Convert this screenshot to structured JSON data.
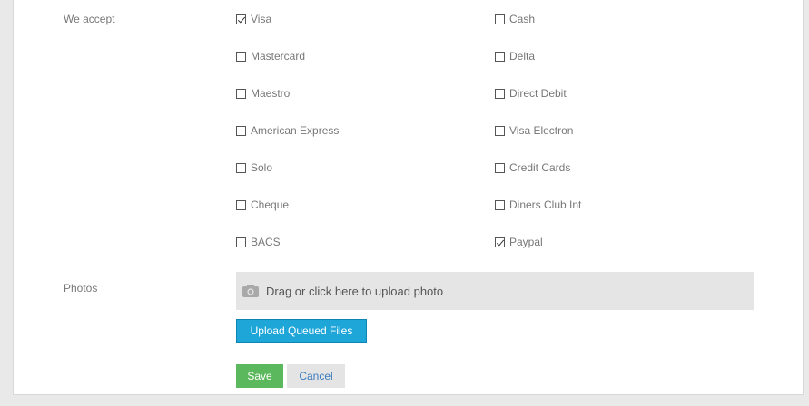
{
  "payment": {
    "label": "We accept",
    "left_options": [
      {
        "label": "Visa",
        "checked": true
      },
      {
        "label": "Mastercard",
        "checked": false
      },
      {
        "label": "Maestro",
        "checked": false
      },
      {
        "label": "American Express",
        "checked": false
      },
      {
        "label": "Solo",
        "checked": false
      },
      {
        "label": "Cheque",
        "checked": false
      },
      {
        "label": "BACS",
        "checked": false
      }
    ],
    "right_options": [
      {
        "label": "Cash",
        "checked": false
      },
      {
        "label": "Delta",
        "checked": false
      },
      {
        "label": "Direct Debit",
        "checked": false
      },
      {
        "label": "Visa Electron",
        "checked": false
      },
      {
        "label": "Credit Cards",
        "checked": false
      },
      {
        "label": "Diners Club Int",
        "checked": false
      },
      {
        "label": "Paypal",
        "checked": true
      }
    ]
  },
  "photos": {
    "label": "Photos",
    "dropzone_text": "Drag or click here to upload photo",
    "dropzone_icon": "camera-icon",
    "upload_button": "Upload Queued Files"
  },
  "actions": {
    "save": "Save",
    "cancel": "Cancel"
  },
  "colors": {
    "upload_button": "#1ea6d9",
    "save_button": "#5cb85c",
    "cancel_text": "#3a7bbf"
  }
}
